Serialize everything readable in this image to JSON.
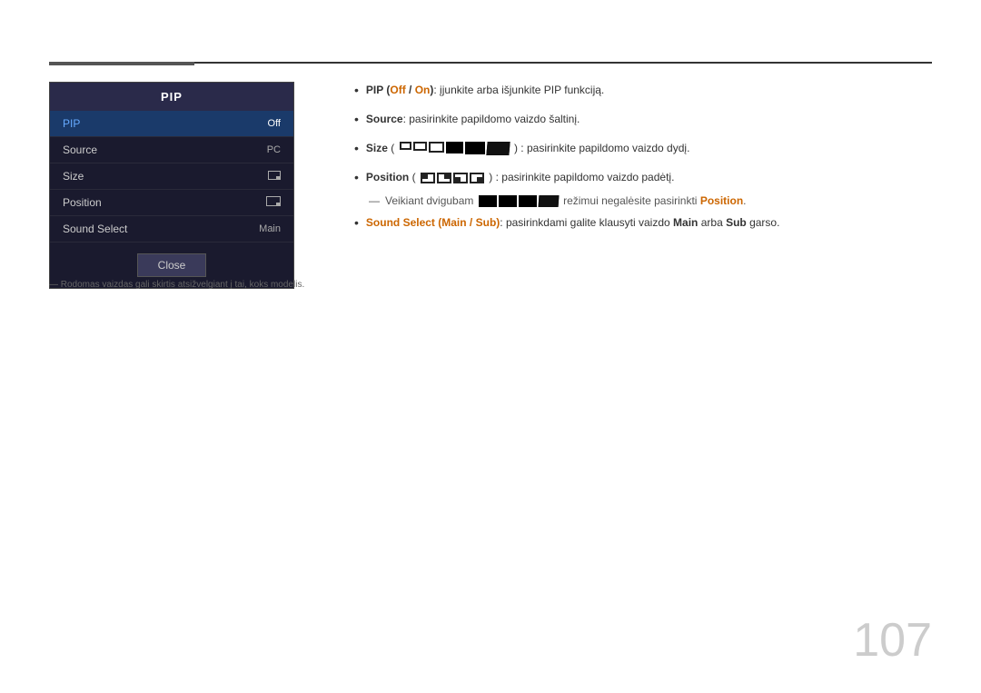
{
  "page": {
    "number": "107"
  },
  "top_rule": {},
  "pip_panel": {
    "title": "PIP",
    "items": [
      {
        "label": "PIP",
        "value": "Off",
        "active": true
      },
      {
        "label": "Source",
        "value": "PC",
        "active": false
      },
      {
        "label": "Size",
        "value": "",
        "active": false,
        "has_pos_icon": false
      },
      {
        "label": "Position",
        "value": "",
        "active": false,
        "has_pos_icon": true
      },
      {
        "label": "Sound Select",
        "value": "Main",
        "active": false
      }
    ],
    "close_button": "Close"
  },
  "footnote": "― Rodomas vaizdas gali skirtis atsižvelgiant į tai, koks modelis.",
  "bullets": [
    {
      "id": "pip",
      "text_parts": [
        {
          "text": "PIP (",
          "style": "bold"
        },
        {
          "text": "Off",
          "style": "orange"
        },
        {
          "text": " / ",
          "style": "bold"
        },
        {
          "text": "On",
          "style": "orange"
        },
        {
          "text": "): įjunkite arba išjunkite PIP funkciją.",
          "style": "normal"
        }
      ]
    },
    {
      "id": "source",
      "text_parts": [
        {
          "text": "Source",
          "style": "bold"
        },
        {
          "text": ": pasirinkite papildomo vaizdo šaltinį.",
          "style": "normal"
        }
      ]
    },
    {
      "id": "size",
      "text_parts": [
        {
          "text": "Size",
          "style": "bold"
        },
        {
          "text": " [icons]: pasirinkite papildomo vaizdo dydį.",
          "style": "normal"
        }
      ]
    },
    {
      "id": "position",
      "text_parts": [
        {
          "text": "Position",
          "style": "bold"
        },
        {
          "text": " [icons]: pasirinkite papildomo vaizdo padėtį.",
          "style": "normal"
        }
      ]
    },
    {
      "id": "sound_select",
      "text_parts": [
        {
          "text": "Sound Select (",
          "style": "bold-orange"
        },
        {
          "text": "Main",
          "style": "orange"
        },
        {
          "text": " / ",
          "style": "bold-orange"
        },
        {
          "text": "Sub",
          "style": "orange"
        },
        {
          "text": "): pasirinkdami galite klausyti vaizdo ",
          "style": "normal"
        },
        {
          "text": "Main",
          "style": "bold"
        },
        {
          "text": " arba ",
          "style": "normal"
        },
        {
          "text": "Sub",
          "style": "bold"
        },
        {
          "text": " garso.",
          "style": "normal"
        }
      ]
    }
  ],
  "dash_note": "Veikiant dvigubam [icons] režimui negalėsite pasirinkti Position."
}
